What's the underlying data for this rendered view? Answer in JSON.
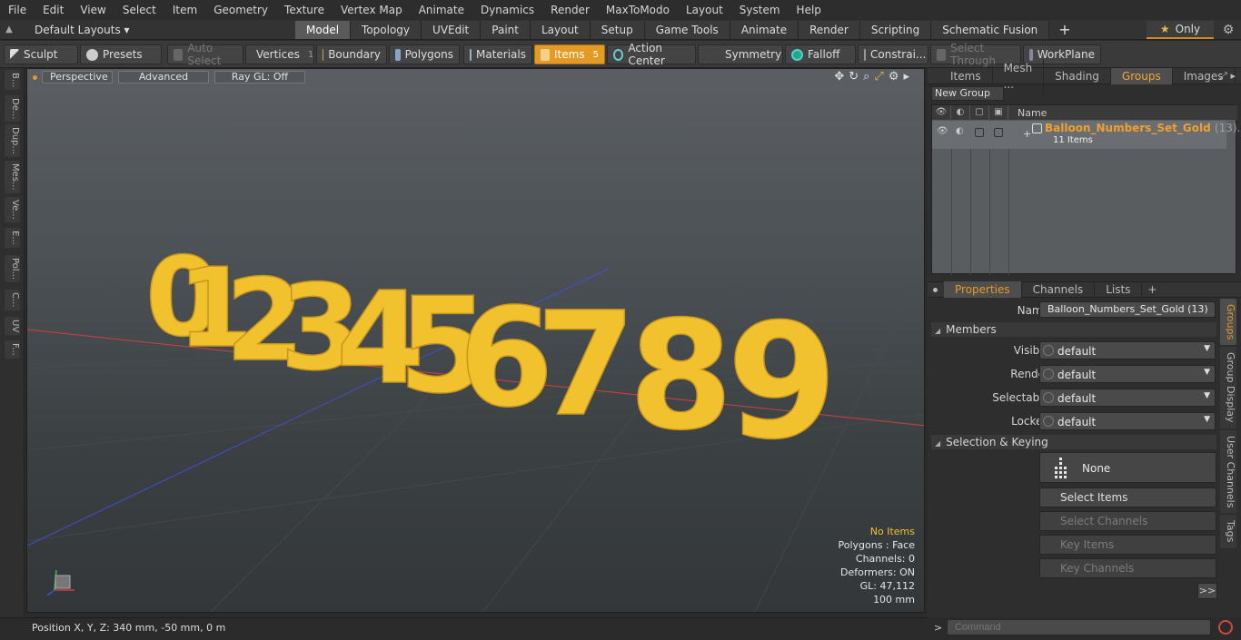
{
  "menu": [
    "File",
    "Edit",
    "View",
    "Select",
    "Item",
    "Geometry",
    "Texture",
    "Vertex Map",
    "Animate",
    "Dynamics",
    "Render",
    "MaxToModo",
    "Layout",
    "System",
    "Help"
  ],
  "layout_bar": {
    "layout_name": "Default Layouts",
    "tabs": [
      "Model",
      "Topology",
      "UVEdit",
      "Paint",
      "Layout",
      "Setup",
      "Game Tools",
      "Animate",
      "Render",
      "Scripting",
      "Schematic Fusion"
    ],
    "active_tab": "Model",
    "only_label": "Only"
  },
  "toolbar": {
    "sculpt": "Sculpt",
    "presets": "Presets",
    "auto_select": "Auto Select",
    "vertices": "Vertices",
    "vertices_count": "1",
    "boundary": "Boundary",
    "polygons": "Polygons",
    "materials": "Materials",
    "items": "Items",
    "items_count": "5",
    "action_center": "Action Center",
    "symmetry": "Symmetry",
    "falloff": "Falloff",
    "constraints": "Constrai...",
    "select_through": "Select Through",
    "workplane": "WorkPlane"
  },
  "left_strip": [
    "B...",
    "De...",
    "Dup...",
    "Mes...",
    "Ve...",
    "E...",
    "Pol...",
    "C...",
    "UV",
    "F..."
  ],
  "viewport": {
    "view_mode": "Perspective",
    "shading": "Advanced",
    "raygl": "Ray GL: Off",
    "digits": [
      "0",
      "1",
      "2",
      "3",
      "4",
      "5",
      "6",
      "7",
      "8",
      "9"
    ],
    "balloon_color": "#f2c12e",
    "info": {
      "no_items": "No Items",
      "polygons": "Polygons : Face",
      "channels": "Channels: 0",
      "deformers": "Deformers: ON",
      "gl": "GL: 47,112",
      "scale": "100 mm"
    }
  },
  "right_top_tabs": [
    "Items",
    "Mesh ...",
    "Shading",
    "Groups",
    "Images"
  ],
  "right_top_active": "Groups",
  "groups": {
    "new_group": "New Group",
    "name_header": "Name",
    "row_name": "Balloon_Numbers_Set_Gold",
    "row_count": "(13)...",
    "row_sub": "11 Items"
  },
  "props_tabs": [
    "Properties",
    "Channels",
    "Lists"
  ],
  "props_active": "Properties",
  "properties": {
    "name_label": "Name",
    "name_value": "Balloon_Numbers_Set_Gold (13)",
    "members_section": "Members",
    "visible_label": "Visible",
    "render_label": "Render",
    "selectable_label": "Selectable",
    "locked_label": "Locked",
    "default_value": "default",
    "selkey_section": "Selection & Keying",
    "none_label": "None",
    "select_items": "Select Items",
    "select_channels": "Select Channels",
    "key_items": "Key Items",
    "key_channels": "Key Channels",
    "more": ">>"
  },
  "vertical_tabs": [
    "Groups",
    "Group Display",
    "User Channels",
    "Tags"
  ],
  "status": {
    "position": "Position X, Y, Z:  340 mm, -50 mm, 0 m"
  },
  "command": {
    "prompt": ">",
    "placeholder": "Command"
  },
  "colors": {
    "accent": "#e39b26",
    "group_name": "#f0a030"
  }
}
